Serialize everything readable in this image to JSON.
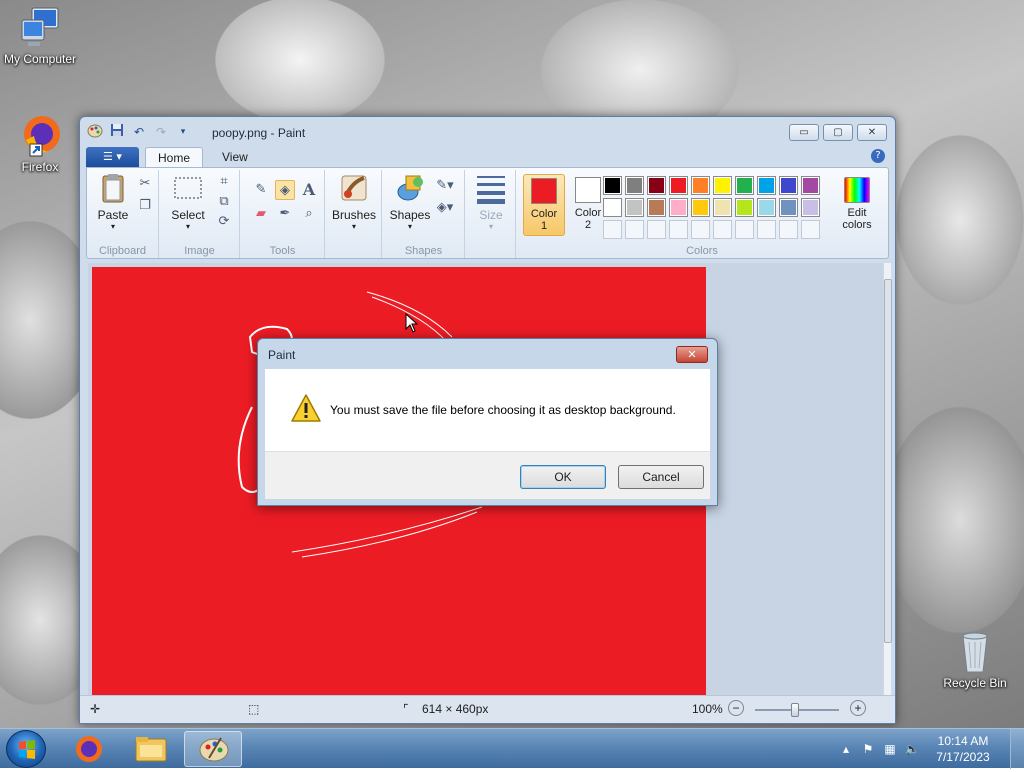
{
  "desktop": {
    "icons": [
      {
        "label": "My Computer",
        "icon": "computer-icon"
      },
      {
        "label": "Firefox",
        "icon": "firefox-icon"
      },
      {
        "label": "Recycle Bin",
        "icon": "recycle-bin-icon"
      }
    ]
  },
  "window": {
    "title": "poopy.png - Paint",
    "quick_access": [
      "save-icon",
      "undo-icon",
      "redo-icon",
      "customize-dropdown-icon"
    ],
    "controls": {
      "minimize": "▭",
      "maximize": "▢",
      "close": "✕"
    }
  },
  "ribbon": {
    "tabs": [
      {
        "label": "Home",
        "active": true
      },
      {
        "label": "View",
        "active": false
      }
    ],
    "groups": {
      "clipboard": {
        "label": "Clipboard",
        "paste": "Paste"
      },
      "image": {
        "label": "Image",
        "select": "Select"
      },
      "tools": {
        "label": "Tools"
      },
      "brushes": {
        "label": "Brushes"
      },
      "shapes": {
        "label": "Shapes",
        "shapes_button": "Shapes"
      },
      "size": {
        "label": "Size"
      },
      "colors": {
        "label": "Colors",
        "color1": "Color",
        "color1_num": "1",
        "color2": "Color",
        "color2_num": "2",
        "color1_value": "#ec1c24",
        "color2_value": "#ffffff",
        "edit_colors": "Edit",
        "edit_colors_2": "colors",
        "palette": [
          "#000000",
          "#7f7f7f",
          "#880015",
          "#ed1c24",
          "#ff7f27",
          "#fff200",
          "#22b14c",
          "#00a2e8",
          "#3f48cc",
          "#a349a4",
          "#ffffff",
          "#c3c3c3",
          "#b97a57",
          "#ffaec9",
          "#ffc90e",
          "#efe4b0",
          "#b5e61d",
          "#99d9ea",
          "#7092be",
          "#c8bfe7"
        ]
      }
    }
  },
  "canvas": {
    "fill_color": "#ec1c24"
  },
  "statusbar": {
    "dimensions": "614 × 460px",
    "zoom": "100%",
    "zoom_level": 1.0
  },
  "dialog": {
    "title": "Paint",
    "message": "You must save the file before choosing it as desktop background.",
    "ok": "OK",
    "cancel": "Cancel",
    "close": "✕"
  },
  "taskbar": {
    "clock_time": "10:14 AM",
    "clock_date": "7/17/2023",
    "items": [
      "firefox-icon",
      "file-explorer-icon",
      "paint-icon"
    ]
  }
}
